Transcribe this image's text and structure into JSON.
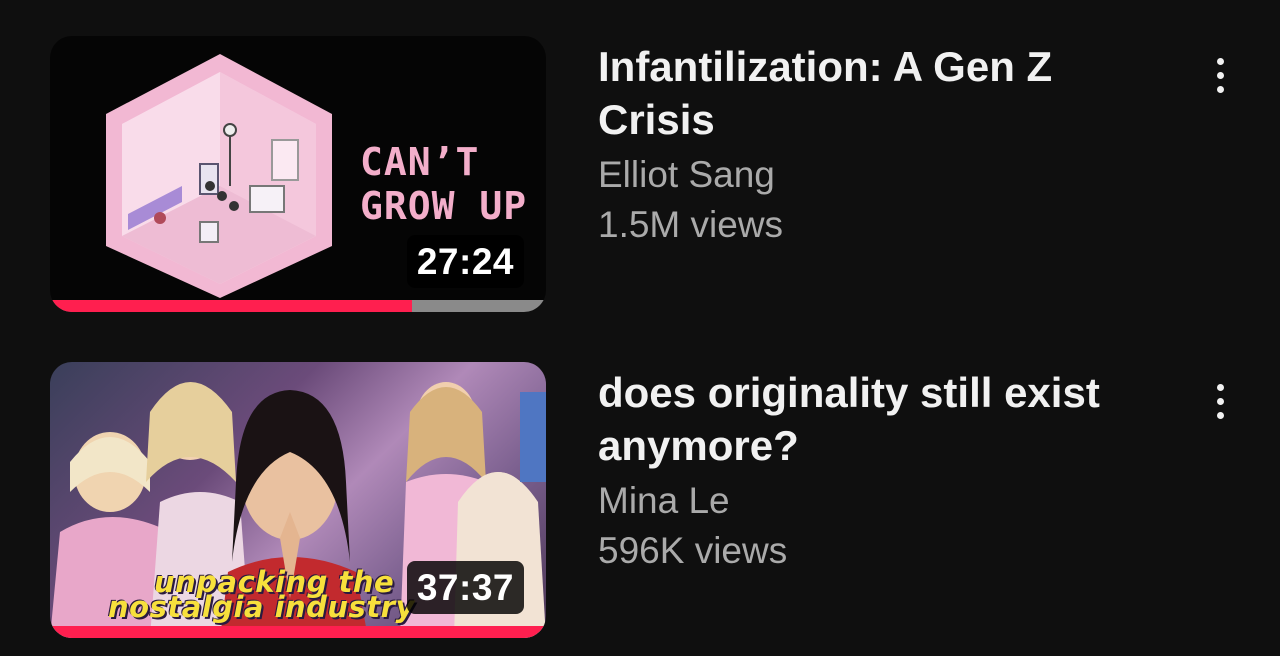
{
  "videos": [
    {
      "title": "Infantilization: A Gen Z Crisis",
      "channel": "Elliot Sang",
      "views": "1.5M views",
      "duration": "27:24",
      "thumbnail_text": [
        "CAN’T",
        "GROW UP"
      ],
      "watch_progress": 0.73,
      "more_icon": "more-vert-icon"
    },
    {
      "title": "does originality still exist anymore?",
      "channel": "Mina Le",
      "views": "596K views",
      "duration": "37:37",
      "thumbnail_text": [
        "unpacking the",
        "nostalgia industry"
      ],
      "watch_progress": 1.0,
      "more_icon": "more-vert-icon"
    }
  ],
  "colors": {
    "background": "#0f0f0f",
    "progress": "#ff1f4f",
    "title": "#f1f1f1",
    "secondary": "#aaaaaa"
  }
}
